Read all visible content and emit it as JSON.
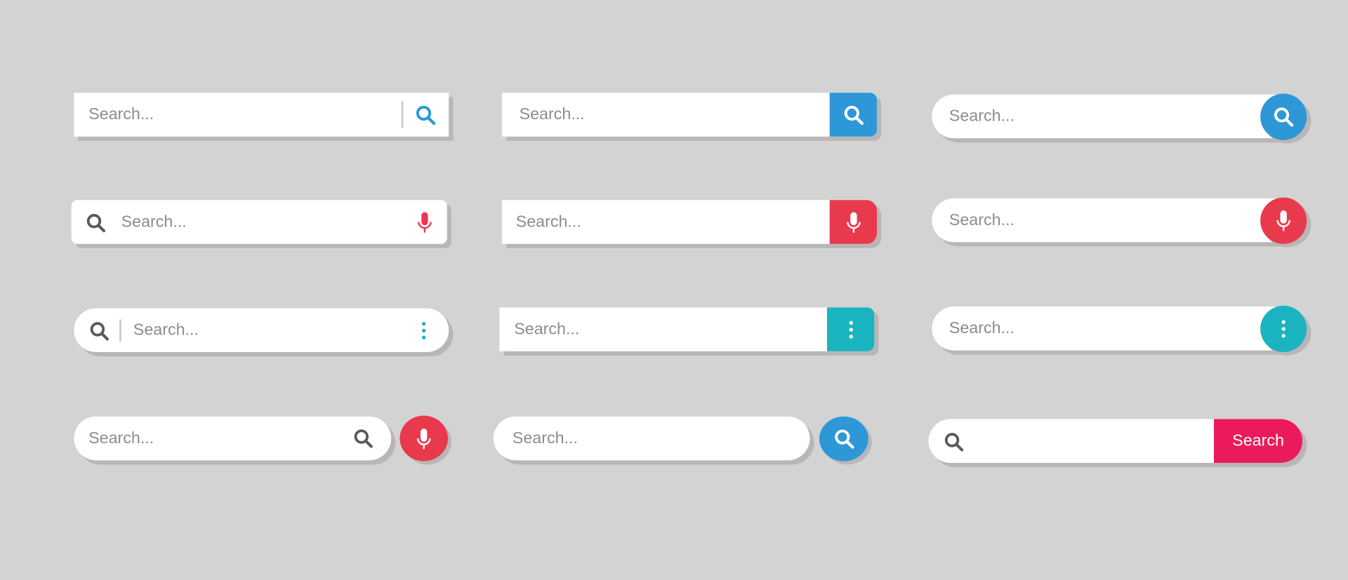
{
  "placeholder": "Search...",
  "button_label": "Search",
  "colors": {
    "blue": "#2d97d8",
    "red": "#e8394d",
    "teal": "#1ab4c0",
    "pink": "#eb1a5c",
    "icon_gray": "#5a5a5a",
    "background": "#d3d3d3"
  },
  "bars": [
    {
      "style": "rect",
      "icon": "search-icon",
      "color": "blue"
    },
    {
      "style": "rect-button",
      "icon": "search-icon",
      "color": "blue"
    },
    {
      "style": "pill-circle",
      "icon": "search-icon",
      "color": "blue"
    },
    {
      "style": "rounded",
      "icon": "microphone-icon",
      "color": "red"
    },
    {
      "style": "rect-button",
      "icon": "microphone-icon",
      "color": "red"
    },
    {
      "style": "pill-circle",
      "icon": "microphone-icon",
      "color": "red"
    },
    {
      "style": "pill",
      "icon": "more-vertical-icon",
      "color": "teal"
    },
    {
      "style": "rect-button",
      "icon": "more-vertical-icon",
      "color": "teal"
    },
    {
      "style": "pill-circle",
      "icon": "more-vertical-icon",
      "color": "teal"
    },
    {
      "style": "pill-separate-circle",
      "icon": "microphone-icon",
      "color": "red"
    },
    {
      "style": "pill-separate-circle",
      "icon": "search-icon",
      "color": "blue"
    },
    {
      "style": "pill-text-button",
      "icon": "search-icon",
      "color": "pink"
    }
  ]
}
